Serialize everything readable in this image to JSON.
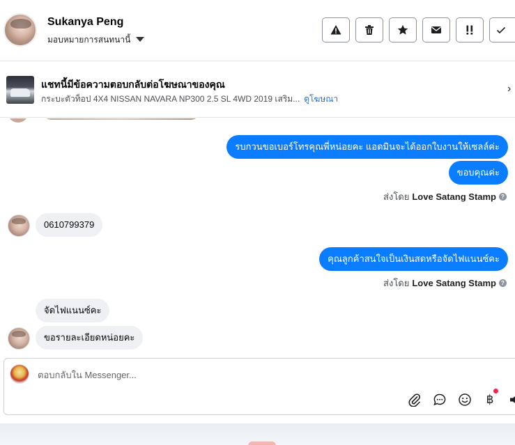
{
  "header": {
    "user_name": "Sukanya Peng",
    "assign_label": "มอบหมายการสนทนานี้",
    "tools": [
      {
        "name": "report",
        "icon": "warning-icon"
      },
      {
        "name": "delete",
        "icon": "trash-icon"
      },
      {
        "name": "star",
        "icon": "star-icon"
      },
      {
        "name": "mark-unread",
        "icon": "envelope-icon"
      },
      {
        "name": "follow-up",
        "icon": "exclamation-icon"
      },
      {
        "name": "done",
        "icon": "check-icon"
      }
    ]
  },
  "ad": {
    "title": "แชทนี้มีข้อความตอบกลับต่อโฆษณาของคุณ",
    "subtitle": "กระบะตัวท็อป 4X4 NISSAN NAVARA NP300 2.5 SL 4WD 2019 เสริม...",
    "link": "ดูโฆษณา"
  },
  "messages": {
    "out_1": "รบกวนขอเบอร์โทรคุณพี่หน่อยคะ แอดมินจะได้ออกใบงานให้เซลล์ค่ะ",
    "out_2": "ขอบคุณค่ะ",
    "sent_by_prefix": "ส่งโดย",
    "sent_by_name": "Love Satang Stamp",
    "in_1": "0610799379",
    "out_3": "คุณลูกค้าสนใจเป็นเงินสดหรือจัดไฟแนนซ์คะ",
    "in_2": "จัดไฟแนนซ์คะ",
    "in_3": "ขอรายละเอียดหน่อยคะ"
  },
  "composer": {
    "placeholder": "ตอบกลับใน Messenger...",
    "icons": [
      "paperclip-icon",
      "chat-bubble-icon",
      "emoji-icon",
      "baht-icon",
      "speaker-icon"
    ],
    "baht_symbol": "฿"
  }
}
